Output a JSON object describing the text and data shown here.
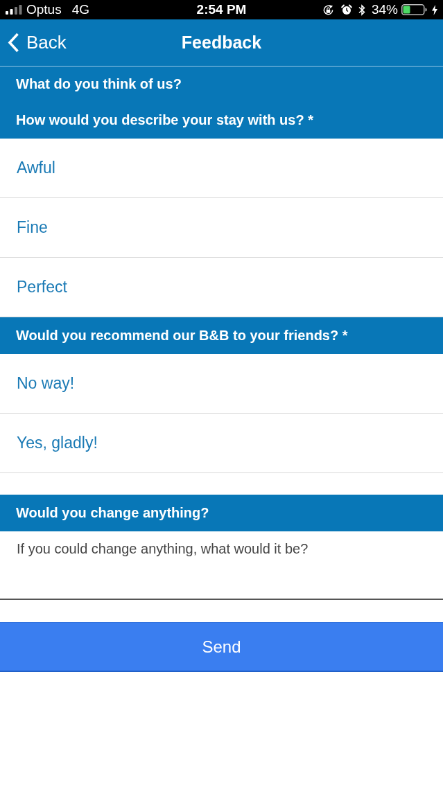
{
  "status_bar": {
    "carrier": "Optus",
    "network": "4G",
    "time": "2:54 PM",
    "battery": "34%"
  },
  "nav_bar": {
    "back": "Back",
    "title": "Feedback"
  },
  "form": {
    "title": "What do you think of us?",
    "questions": [
      {
        "kind": "choice",
        "label": "How would you describe your stay with us? *",
        "options": [
          {
            "label": "Awful",
            "selected": false
          },
          {
            "label": "Fine",
            "selected": false
          },
          {
            "label": "Perfect",
            "selected": false
          }
        ]
      },
      {
        "kind": "choice",
        "label": "Would you recommend our B&B to your friends? *",
        "options": [
          {
            "label": "No way!",
            "selected": false
          },
          {
            "label": "Yes, gladly!",
            "selected": false
          }
        ]
      },
      {
        "kind": "text",
        "label": "Would you change anything?",
        "placeholder": "If you could change anything, what would it be?"
      }
    ],
    "submit": "Send"
  }
}
